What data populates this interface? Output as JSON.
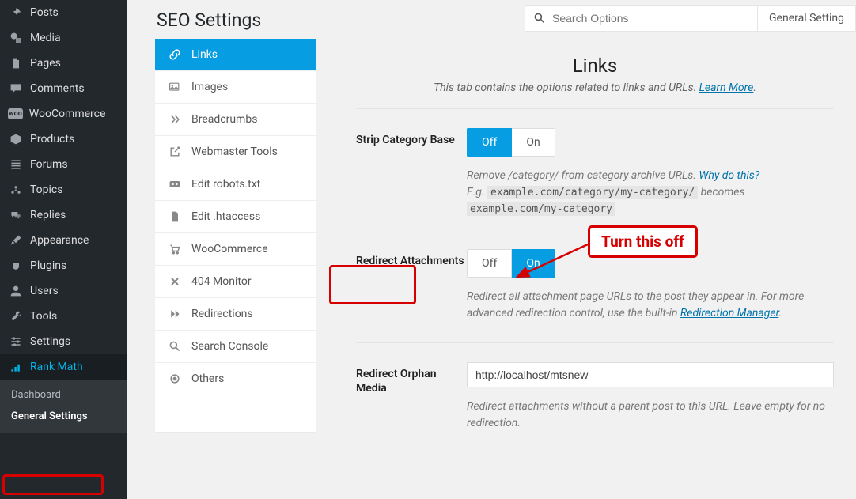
{
  "wp_menu": [
    {
      "icon": "pin",
      "label": "Posts"
    },
    {
      "icon": "media",
      "label": "Media"
    },
    {
      "icon": "page",
      "label": "Pages"
    },
    {
      "icon": "comment",
      "label": "Comments"
    },
    {
      "icon": "woo",
      "label": "WooCommerce"
    },
    {
      "icon": "box",
      "label": "Products"
    },
    {
      "icon": "forums",
      "label": "Forums"
    },
    {
      "icon": "topics",
      "label": "Topics"
    },
    {
      "icon": "replies",
      "label": "Replies"
    },
    {
      "icon": "brush",
      "label": "Appearance"
    },
    {
      "icon": "plug",
      "label": "Plugins"
    },
    {
      "icon": "user",
      "label": "Users"
    },
    {
      "icon": "wrench",
      "label": "Tools"
    },
    {
      "icon": "sliders",
      "label": "Settings"
    },
    {
      "icon": "chart",
      "label": "Rank Math"
    }
  ],
  "wp_submenu": [
    "Dashboard",
    "General Settings"
  ],
  "page_title": "SEO Settings",
  "search_placeholder": "Search Options",
  "general_button": "General Setting",
  "tabs": [
    {
      "icon": "link",
      "label": "Links"
    },
    {
      "icon": "images",
      "label": "Images"
    },
    {
      "icon": "chev",
      "label": "Breadcrumbs"
    },
    {
      "icon": "external",
      "label": "Webmaster Tools"
    },
    {
      "icon": "camera",
      "label": "Edit robots.txt"
    },
    {
      "icon": "file",
      "label": "Edit .htaccess"
    },
    {
      "icon": "cart",
      "label": "WooCommerce"
    },
    {
      "icon": "x",
      "label": "404 Monitor"
    },
    {
      "icon": "forward",
      "label": "Redirections"
    },
    {
      "icon": "search",
      "label": "Search Console"
    },
    {
      "icon": "circle",
      "label": "Others"
    }
  ],
  "panel": {
    "title": "Links",
    "subtitle_pre": "This tab contains the options related to links and URLs. ",
    "learn_more": "Learn More",
    "strip": {
      "label": "Strip Category Base",
      "off": "Off",
      "on": "On",
      "value": "Off",
      "help_pre": "Remove /category/ from category archive URLs. ",
      "why": "Why do this?",
      "eg_label": "E.g. ",
      "eg_from": "example.com/category/my-category/",
      "eg_mid": " becomes ",
      "eg_to": "example.com/my-category"
    },
    "redirect_att": {
      "label": "Redirect Attachments",
      "off": "Off",
      "on": "On",
      "value": "On",
      "help_pre": "Redirect all attachment page URLs to the post they appear in. For more advanced redirection control, use the built-in ",
      "help_link": "Redirection Manager",
      "help_post": "."
    },
    "orphan": {
      "label": "Redirect Orphan Media",
      "value": "http://localhost/mtsnew",
      "help": "Redirect attachments without a parent post to this URL. Leave empty for no redirection."
    }
  },
  "annotation": {
    "callout": "Turn this off"
  }
}
